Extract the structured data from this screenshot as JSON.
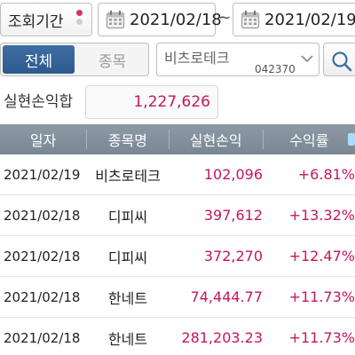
{
  "period": {
    "label": "조회기간",
    "from_date": "2021/02/18",
    "separator": "~",
    "to_date": "2021/02/19"
  },
  "tabs": {
    "all_label": "전체",
    "stock_label": "종목"
  },
  "stock_select": {
    "name": "비츠로테크",
    "code": "042370"
  },
  "summary": {
    "label": "실현손익합",
    "value": "1,227,626"
  },
  "table": {
    "headers": [
      "일자",
      "종목명",
      "실현손익",
      "수익률"
    ],
    "rows": [
      {
        "date": "2021/02/19",
        "name": "비츠로테크",
        "profit": "102,096",
        "rate": "+6.81%"
      },
      {
        "date": "2021/02/18",
        "name": "디피씨",
        "profit": "397,612",
        "rate": "+13.32%"
      },
      {
        "date": "2021/02/18",
        "name": "디피씨",
        "profit": "372,270",
        "rate": "+12.47%"
      },
      {
        "date": "2021/02/18",
        "name": "한네트",
        "profit": "74,444.77",
        "rate": "+11.73%"
      },
      {
        "date": "2021/02/18",
        "name": "한네트",
        "profit": "281,203.23",
        "rate": "+11.73%"
      }
    ]
  },
  "colors": {
    "accent_tab": "#2d5a8e",
    "profit_text": "#c2185b",
    "header_bg": "#7a8793"
  },
  "icons": {
    "calendar": "calendar-icon",
    "search": "search-icon",
    "chevron": "chevron-down-icon"
  }
}
